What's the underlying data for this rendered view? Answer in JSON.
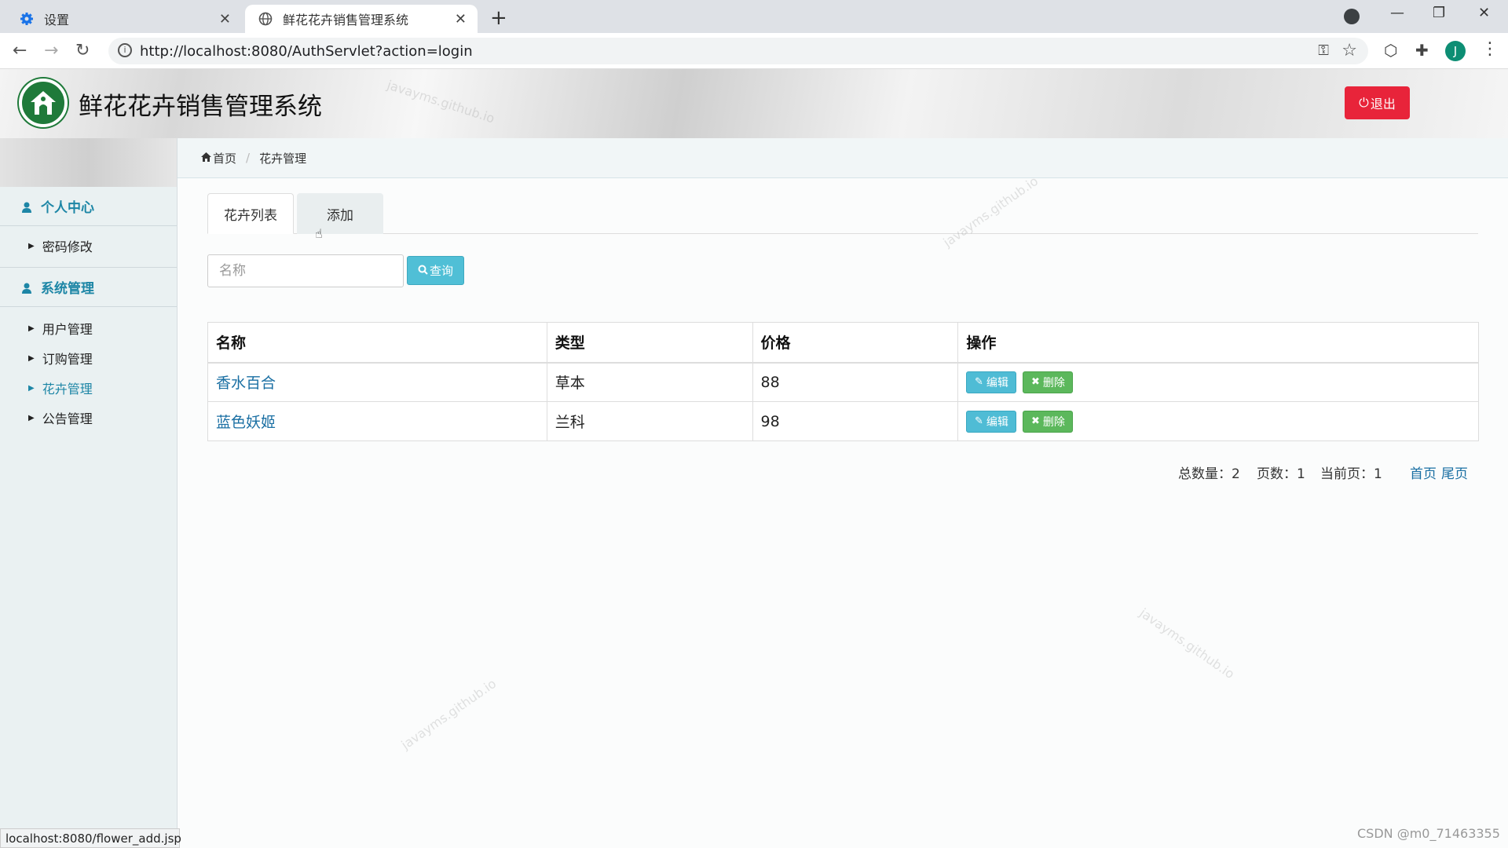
{
  "browser": {
    "tabs": [
      {
        "title": "设置",
        "icon": "gear-icon",
        "active": false
      },
      {
        "title": "鲜花花卉销售管理系统",
        "icon": "globe-icon",
        "active": true
      }
    ],
    "url": "http://localhost:8080/AuthServlet?action=login",
    "profile_initial": "J",
    "status_url": "localhost:8080/flower_add.jsp"
  },
  "header": {
    "title": "鲜花花卉销售管理系统",
    "logout_label": "退出"
  },
  "sidebar": {
    "sections": [
      {
        "title": "个人中心",
        "items": [
          {
            "label": "密码修改",
            "active": false
          }
        ]
      },
      {
        "title": "系统管理",
        "items": [
          {
            "label": "用户管理",
            "active": false
          },
          {
            "label": "订购管理",
            "active": false
          },
          {
            "label": "花卉管理",
            "active": true
          },
          {
            "label": "公告管理",
            "active": false
          }
        ]
      }
    ]
  },
  "breadcrumb": {
    "home": "首页",
    "current": "花卉管理"
  },
  "tabs": {
    "list": "花卉列表",
    "add": "添加"
  },
  "search": {
    "placeholder": "名称",
    "button": "查询"
  },
  "table": {
    "headers": [
      "名称",
      "类型",
      "价格",
      "操作"
    ],
    "rows": [
      {
        "name": "香水百合",
        "type": "草本",
        "price": "88"
      },
      {
        "name": "蓝色妖姬",
        "type": "兰科",
        "price": "98"
      }
    ],
    "edit_label": "编辑",
    "delete_label": "删除"
  },
  "pager": {
    "total": "总数量：2",
    "pages": "页数：1",
    "current": "当前页：1",
    "first": "首页",
    "last": "尾页"
  },
  "watermark": "javayms.github.io",
  "credit": "CSDN @m0_71463355",
  "colors": {
    "accent": "#1d86a6",
    "logout": "#e8243a",
    "search_button": "#50bfd6",
    "edit_button": "#4fbcd5",
    "delete_button": "#5cb85c",
    "link": "#1a6fa3"
  }
}
